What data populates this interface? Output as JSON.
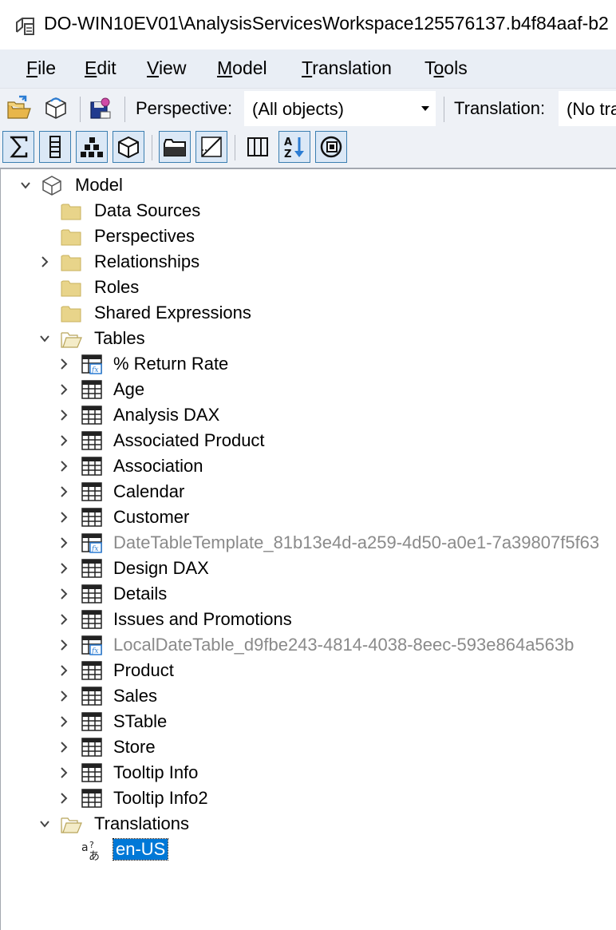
{
  "window": {
    "title": "DO-WIN10EV01\\AnalysisServicesWorkspace125576137.b4f84aaf-b2"
  },
  "menu": [
    {
      "pre": "",
      "u": "F",
      "post": "ile"
    },
    {
      "pre": "",
      "u": "E",
      "post": "dit"
    },
    {
      "pre": "",
      "u": "V",
      "post": "iew"
    },
    {
      "pre": "",
      "u": "M",
      "post": "odel"
    },
    {
      "pre": "",
      "u": "T",
      "post": "ranslation"
    },
    {
      "pre": "T",
      "u": "o",
      "post": "ols"
    }
  ],
  "toolbar": {
    "perspective_label": "Perspective:",
    "perspective_value": "(All objects)",
    "translation_label": "Translation:",
    "translation_value": "(No tra"
  },
  "tree": {
    "rows": [
      {
        "label": "Model",
        "icon": "model-cube-icon",
        "indent": 0,
        "expander": "expanded"
      },
      {
        "label": "Data Sources",
        "icon": "folder-icon",
        "indent": 1,
        "expander": "none"
      },
      {
        "label": "Perspectives",
        "icon": "folder-icon",
        "indent": 1,
        "expander": "none"
      },
      {
        "label": "Relationships",
        "icon": "folder-icon",
        "indent": 1,
        "expander": "collapsed"
      },
      {
        "label": "Roles",
        "icon": "folder-icon",
        "indent": 1,
        "expander": "none"
      },
      {
        "label": "Shared Expressions",
        "icon": "folder-icon",
        "indent": 1,
        "expander": "none"
      },
      {
        "label": "Tables",
        "icon": "folder-open-icon",
        "indent": 1,
        "expander": "expanded"
      },
      {
        "label": "% Return Rate",
        "icon": "calc-table-icon",
        "indent": 2,
        "expander": "collapsed"
      },
      {
        "label": "Age",
        "icon": "table-icon",
        "indent": 2,
        "expander": "collapsed"
      },
      {
        "label": "Analysis DAX",
        "icon": "table-icon",
        "indent": 2,
        "expander": "collapsed"
      },
      {
        "label": "Associated Product",
        "icon": "table-icon",
        "indent": 2,
        "expander": "collapsed"
      },
      {
        "label": "Association",
        "icon": "table-icon",
        "indent": 2,
        "expander": "collapsed"
      },
      {
        "label": "Calendar",
        "icon": "table-icon",
        "indent": 2,
        "expander": "collapsed"
      },
      {
        "label": "Customer",
        "icon": "table-icon",
        "indent": 2,
        "expander": "collapsed"
      },
      {
        "label": "DateTableTemplate_81b13e4d-a259-4d50-a0e1-7a39807f5f63",
        "icon": "calc-table-icon",
        "indent": 2,
        "expander": "collapsed",
        "hidden": true
      },
      {
        "label": "Design DAX",
        "icon": "table-icon",
        "indent": 2,
        "expander": "collapsed"
      },
      {
        "label": "Details",
        "icon": "table-icon",
        "indent": 2,
        "expander": "collapsed"
      },
      {
        "label": "Issues and Promotions",
        "icon": "table-icon",
        "indent": 2,
        "expander": "collapsed"
      },
      {
        "label": "LocalDateTable_d9fbe243-4814-4038-8eec-593e864a563b",
        "icon": "calc-table-icon",
        "indent": 2,
        "expander": "collapsed",
        "hidden": true
      },
      {
        "label": "Product",
        "icon": "table-icon",
        "indent": 2,
        "expander": "collapsed"
      },
      {
        "label": "Sales",
        "icon": "table-icon",
        "indent": 2,
        "expander": "collapsed"
      },
      {
        "label": "STable",
        "icon": "table-icon",
        "indent": 2,
        "expander": "collapsed"
      },
      {
        "label": "Store",
        "icon": "table-icon",
        "indent": 2,
        "expander": "collapsed"
      },
      {
        "label": "Tooltip Info",
        "icon": "table-icon",
        "indent": 2,
        "expander": "collapsed"
      },
      {
        "label": "Tooltip Info2",
        "icon": "table-icon",
        "indent": 2,
        "expander": "collapsed"
      },
      {
        "label": "Translations",
        "icon": "folder-open-icon",
        "indent": 1,
        "expander": "expanded"
      },
      {
        "label": "en-US",
        "icon": "translation-icon",
        "indent": 2,
        "expander": "none",
        "selected": true
      }
    ]
  },
  "colors": {
    "menubar": "#e9eef5",
    "toolbar": "#eef1f6",
    "selection": "#0078d7",
    "hidden_text": "#8a8a8a",
    "folder": "#e8d48a"
  }
}
